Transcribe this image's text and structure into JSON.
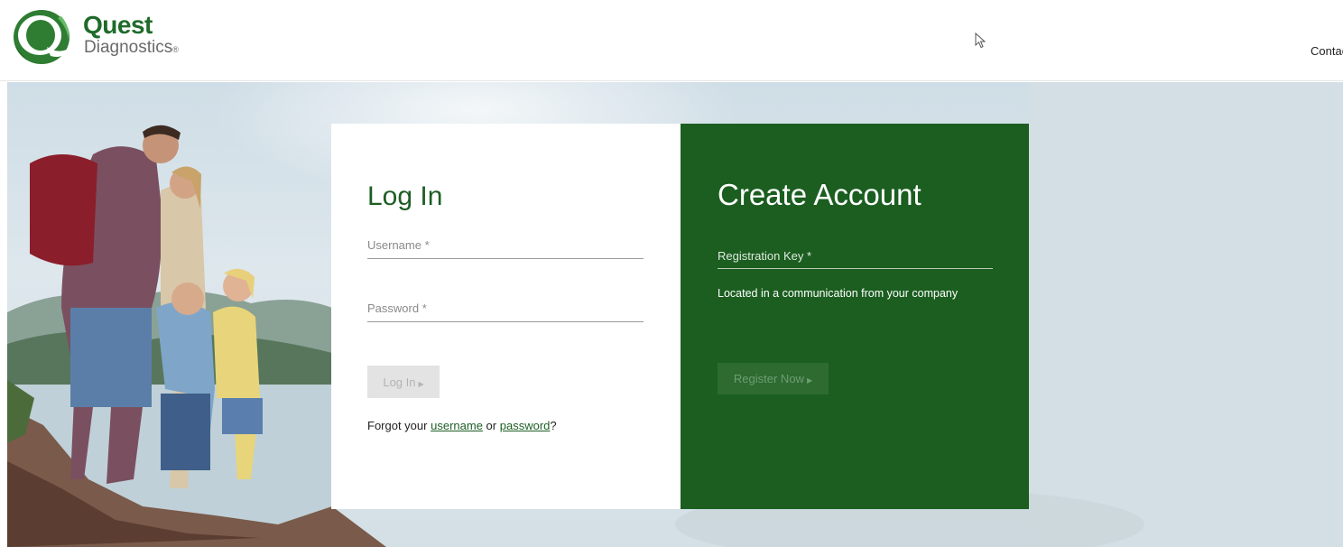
{
  "header": {
    "logo_word": "Quest",
    "logo_sub": "Diagnostics",
    "logo_reg": "®",
    "contact_label": "Contact"
  },
  "login": {
    "title": "Log In",
    "username_label": "Username *",
    "password_label": "Password *",
    "button_label": "Log In",
    "forgot_prefix": "Forgot your",
    "forgot_username": "username",
    "forgot_or": "or",
    "forgot_password": "password",
    "forgot_suffix": "?"
  },
  "create": {
    "title": "Create Account",
    "regkey_label": "Registration Key *",
    "hint": "Located in a communication from your company",
    "button_label": "Register Now"
  },
  "icons": {
    "logo": "quest-q-logo-icon",
    "cursor": "mouse-pointer-icon",
    "arrow": "caret-right-icon"
  },
  "colors": {
    "brand_green": "#1b5e20",
    "login_card": "#ffffff",
    "button_disabled": "#e3e3e3"
  }
}
